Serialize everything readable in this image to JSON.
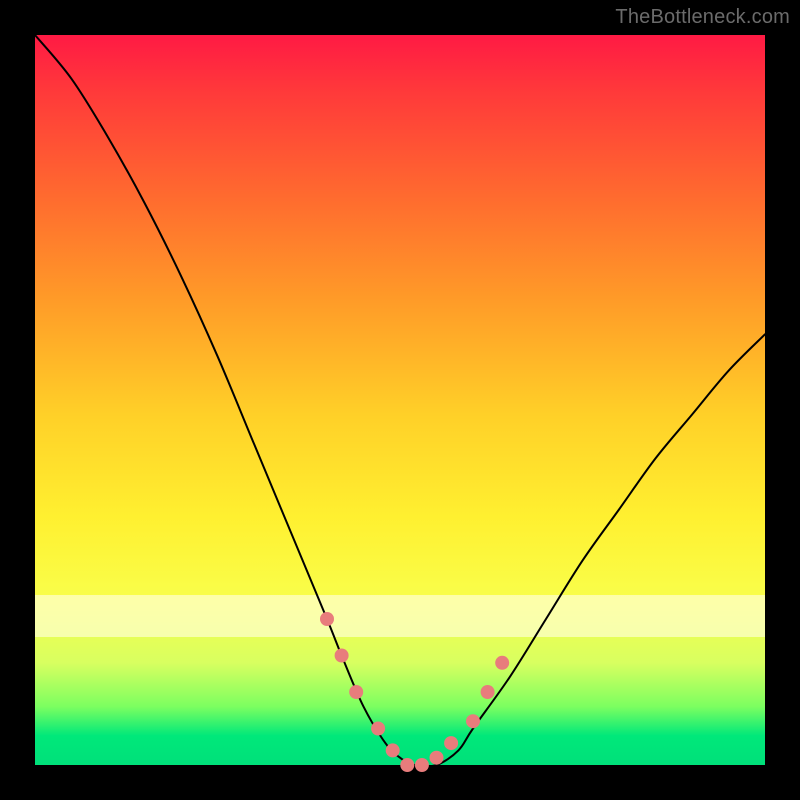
{
  "watermark": "TheBottleneck.com",
  "chart_data": {
    "type": "line",
    "title": "",
    "xlabel": "",
    "ylabel": "",
    "xlim": [
      0,
      100
    ],
    "ylim": [
      0,
      100
    ],
    "series": [
      {
        "name": "bottleneck-curve",
        "x": [
          0,
          5,
          10,
          15,
          20,
          25,
          30,
          35,
          40,
          42,
          45,
          48,
          50,
          52,
          55,
          58,
          60,
          65,
          70,
          75,
          80,
          85,
          90,
          95,
          100
        ],
        "y": [
          100,
          94,
          86,
          77,
          67,
          56,
          44,
          32,
          20,
          15,
          8,
          3,
          1,
          0,
          0,
          2,
          5,
          12,
          20,
          28,
          35,
          42,
          48,
          54,
          59
        ]
      }
    ],
    "markers": {
      "name": "highlighted-points",
      "x": [
        40,
        42,
        44,
        47,
        49,
        51,
        53,
        55,
        57,
        60,
        62,
        64
      ],
      "y": [
        20,
        15,
        10,
        5,
        2,
        0,
        0,
        1,
        3,
        6,
        10,
        14
      ]
    },
    "highlight_band_y": [
      18,
      24
    ]
  }
}
